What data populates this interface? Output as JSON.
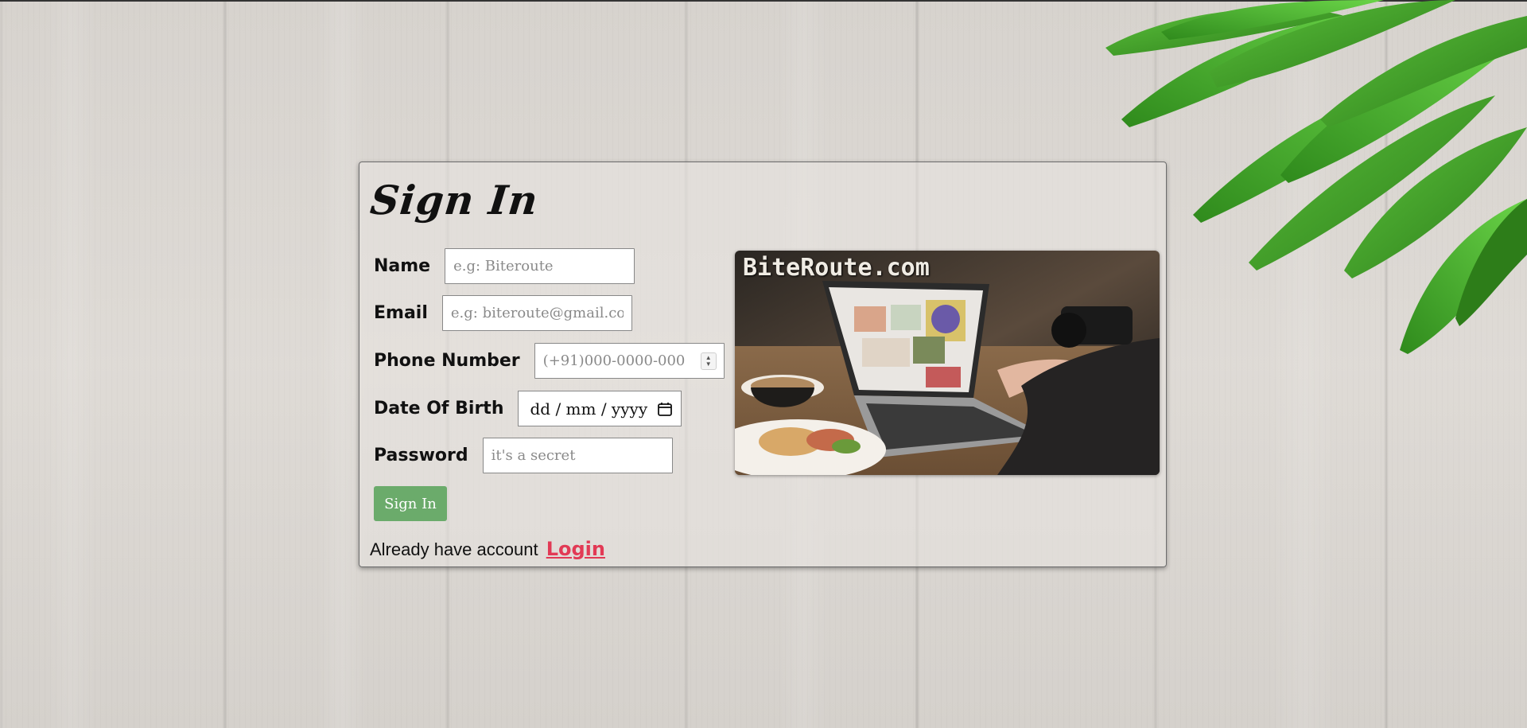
{
  "form": {
    "title": "Sign In",
    "fields": {
      "name": {
        "label": "Name",
        "placeholder": "e.g: Biteroute"
      },
      "email": {
        "label": "Email",
        "placeholder": "e.g: biteroute@gmail.com"
      },
      "phone": {
        "label": "Phone Number",
        "placeholder": "(+91)000-0000-000"
      },
      "dob": {
        "label": "Date Of Birth",
        "value": "dd / mm / yyyy"
      },
      "password": {
        "label": "Password",
        "placeholder": "it's a secret"
      }
    },
    "submit_label": "Sign In",
    "footer_text": "Already have account",
    "footer_link": "Login"
  },
  "promo": {
    "title": "BiteRoute.com"
  },
  "colors": {
    "submit": "#6bab6b",
    "link": "#e23a55",
    "leaf": "#3f9a26"
  },
  "icons": [
    "calendar-icon",
    "spinner-arrows-icon"
  ]
}
